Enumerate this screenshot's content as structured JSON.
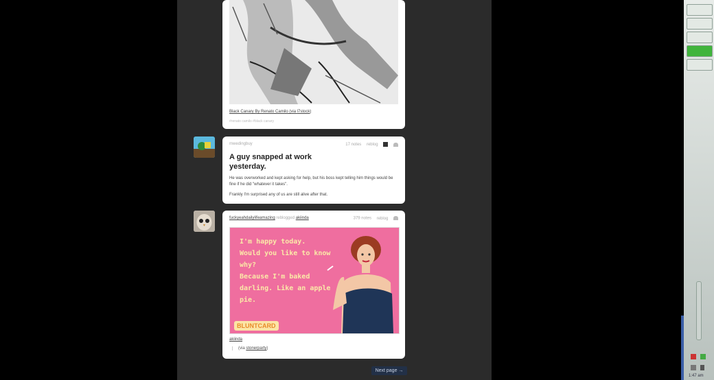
{
  "posts": [
    {
      "caption_before": "Black Canary By Renato Camilo (via ",
      "caption_link": "l7stock",
      "caption_after": ")",
      "tags": "#renato camilo   #black canary"
    },
    {
      "user": "mwedingbuy",
      "notes": "17 notes",
      "reblog": "reblog",
      "title": "A guy snapped at work yesterday.",
      "body1": "He was overworked and kept asking for help, but his boss kept telling him things would be fine if he did \"whatever it takes\".",
      "body2": "Frankly I'm surprised any of us are still alive after that."
    },
    {
      "user": "fuckyeahdailylifeamazing",
      "reblogged_text": "reblogged",
      "reblogged_from": "akiinda",
      "notes": "379 notes",
      "reblog": "reblog",
      "card_text": "I'm happy today.\nWould you like to know why?\nBecause I'm baked\ndarling. Like an apple\npie.",
      "card_brand": "BLUNTCARD",
      "source_link": "akiinda",
      "via_prefix": "(via ",
      "via_link": "stonerparty",
      "via_suffix": ")"
    }
  ],
  "next_page": "Next page →",
  "clock": "1:47 am",
  "colors": {
    "card_pink": "#ef6e9f",
    "sidebar_active": "#40b43c"
  }
}
